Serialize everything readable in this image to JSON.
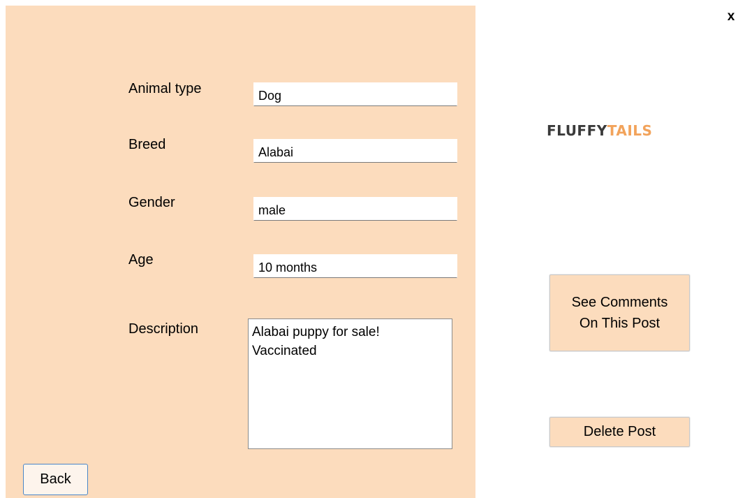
{
  "window": {
    "close_label": "x"
  },
  "form": {
    "fields": [
      {
        "label": "Animal type",
        "value": "Dog"
      },
      {
        "label": "Breed",
        "value": "Alabai"
      },
      {
        "label": "Gender",
        "value": "male"
      },
      {
        "label": "Age",
        "value": "10 months"
      }
    ],
    "description": {
      "label": "Description",
      "value": "Alabai puppy for sale!\nVaccinated"
    },
    "back_label": "Back"
  },
  "logo": {
    "part1": "FLUFFY",
    "part2": "TAILS"
  },
  "actions": {
    "comments_line1": "See Comments",
    "comments_line2": "On This Post",
    "delete_label": "Delete Post"
  },
  "colors": {
    "panel_background": "#fcdcbd",
    "logo_dark": "#3a3a3a",
    "logo_accent": "#f2a35b",
    "back_button_border": "#4a86c8"
  }
}
